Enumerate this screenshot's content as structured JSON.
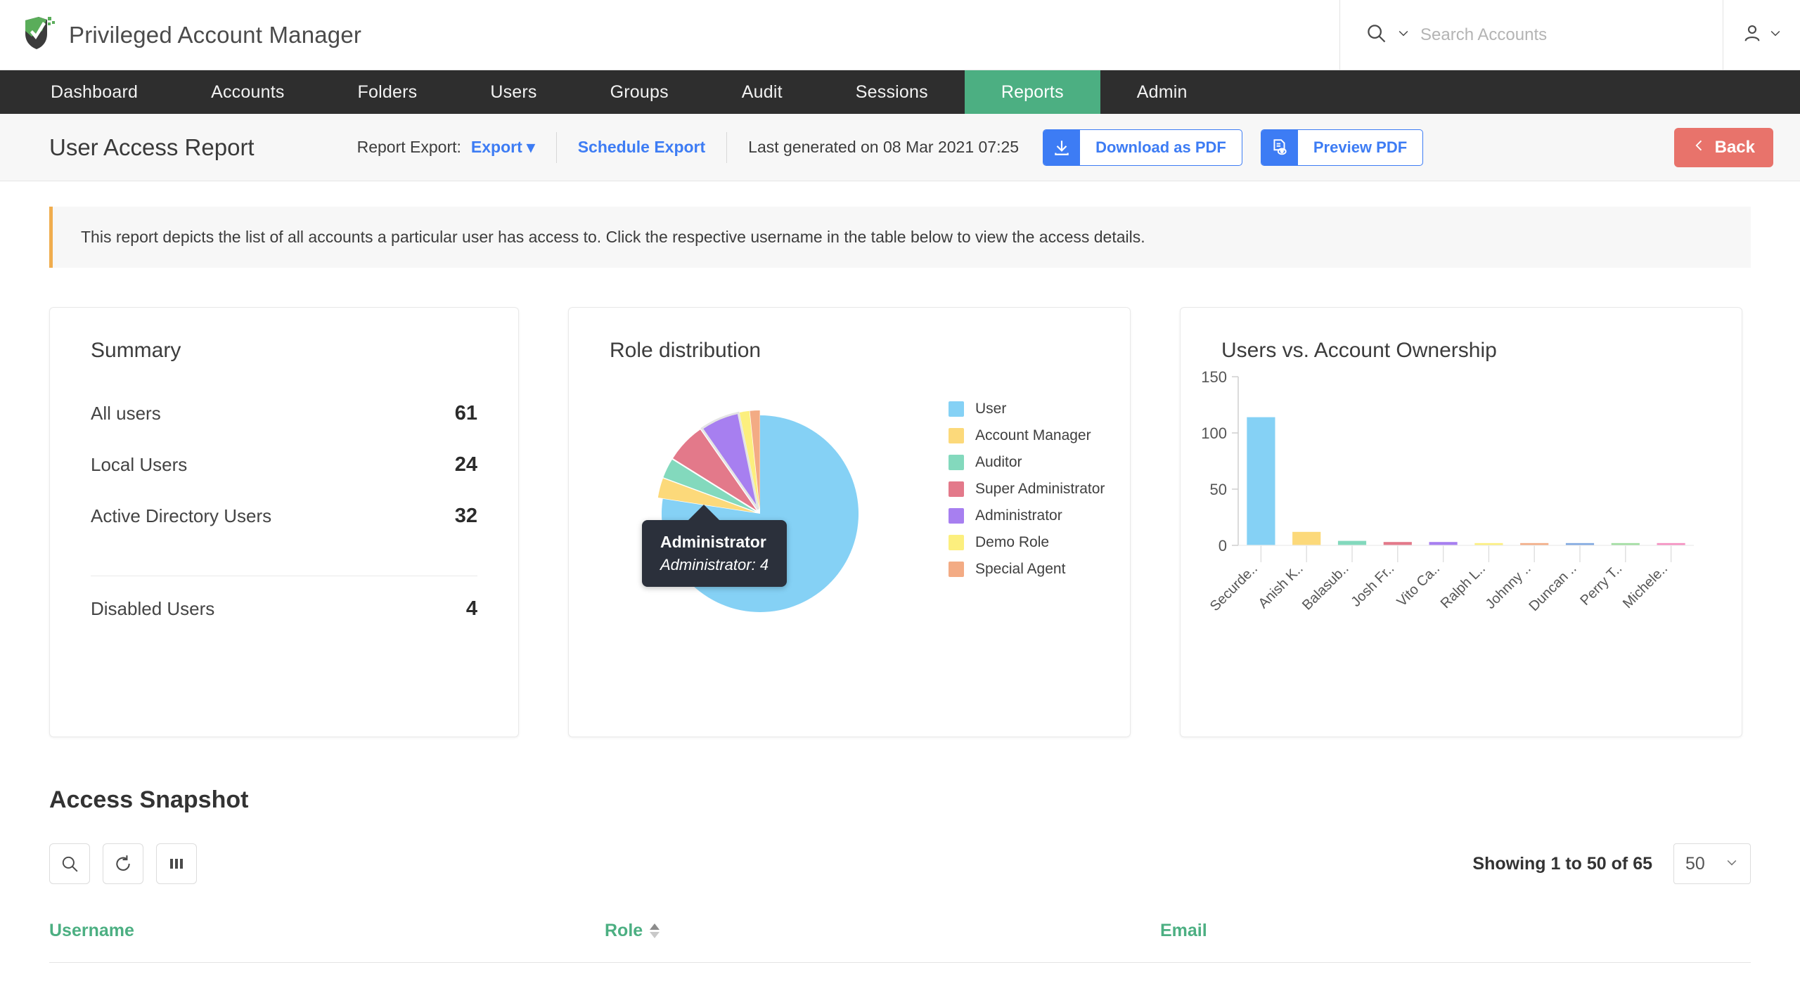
{
  "app": {
    "title": "Privileged Account Manager",
    "logo_icon": "shield-check-icon"
  },
  "search": {
    "icon": "search-icon",
    "dropdown_icon": "chevron-down-icon",
    "placeholder": "Search Accounts",
    "value": ""
  },
  "user_menu": {
    "icon": "user-icon",
    "dropdown_icon": "chevron-down-icon"
  },
  "nav": {
    "items": [
      {
        "label": "Dashboard",
        "active": false
      },
      {
        "label": "Accounts",
        "active": false
      },
      {
        "label": "Folders",
        "active": false
      },
      {
        "label": "Users",
        "active": false
      },
      {
        "label": "Groups",
        "active": false
      },
      {
        "label": "Audit",
        "active": false
      },
      {
        "label": "Sessions",
        "active": false
      },
      {
        "label": "Reports",
        "active": true
      },
      {
        "label": "Admin",
        "active": false
      }
    ],
    "active_color": "#4caf82",
    "bar_color": "#2e2e2e"
  },
  "toolbar": {
    "page_title": "User Access Report",
    "report_export_label": "Report Export:",
    "export_label": "Export",
    "export_caret": "caret-down-icon",
    "schedule_export_label": "Schedule Export",
    "last_generated": "Last generated on 08 Mar 2021 07:25",
    "download_pdf_label": "Download as PDF",
    "download_icon": "download-icon",
    "preview_pdf_label": "Preview PDF",
    "preview_icon": "document-eye-icon",
    "back_label": "Back",
    "back_icon": "chevron-left-icon",
    "link_color": "#3d7cf4",
    "back_color": "#e8736b"
  },
  "banner": {
    "text": "This report depicts the list of all accounts a particular user has access to. Click the respective username in the table below to view the access details.",
    "accent_color": "#f0ad4e"
  },
  "summary": {
    "title": "Summary",
    "rows": [
      {
        "label": "All users",
        "value": "61"
      },
      {
        "label": "Local Users",
        "value": "24"
      },
      {
        "label": "Active Directory Users",
        "value": "32"
      }
    ],
    "footer_row": {
      "label": "Disabled Users",
      "value": "4"
    }
  },
  "role_distribution": {
    "title": "Role distribution",
    "tooltip": {
      "title": "Administrator",
      "detail": "Administrator: 4"
    }
  },
  "ownership": {
    "title": "Users vs. Account Ownership"
  },
  "access_snapshot": {
    "title": "Access Snapshot",
    "buttons": [
      {
        "icon": "search-icon",
        "name": "search-button"
      },
      {
        "icon": "refresh-icon",
        "name": "refresh-button"
      },
      {
        "icon": "columns-icon",
        "name": "columns-button"
      }
    ],
    "showing_text": "Showing 1 to 50 of 65",
    "page_size": "50",
    "page_size_caret": "chevron-down-icon",
    "columns": [
      {
        "label": "Username",
        "sortable": false
      },
      {
        "label": "Role",
        "sortable": true
      },
      {
        "label": "Email",
        "sortable": false
      }
    ],
    "header_color": "#4caf82"
  },
  "chart_data": [
    {
      "type": "pie",
      "title": "Role distribution",
      "legend_position": "right",
      "categories": [
        "User",
        "Account Manager",
        "Auditor",
        "Super Administrator",
        "Administrator",
        "Demo Role",
        "Special Agent"
      ],
      "values": [
        48,
        2,
        2,
        4,
        4,
        1,
        1
      ],
      "colors": [
        "#85d1f5",
        "#fcd97a",
        "#83d9bd",
        "#e3798a",
        "#a77ff0",
        "#fcef7e",
        "#f3ab84"
      ],
      "highlighted": "Administrator",
      "tooltip": {
        "label": "Administrator",
        "series": "Administrator",
        "value": 4
      }
    },
    {
      "type": "bar",
      "title": "Users vs. Account Ownership",
      "xlabel": "",
      "ylabel": "",
      "ylim": [
        0,
        150
      ],
      "yticks": [
        0,
        50,
        100,
        150
      ],
      "grid": false,
      "categories": [
        "Securde..",
        "Anish K..",
        "Balasub..",
        "Josh Fr..",
        "Vito Ca..",
        "Ralph L..",
        "Johnny ..",
        "Duncan ..",
        "Perry T..",
        "Michele.."
      ],
      "values": [
        114,
        12,
        4,
        3,
        3,
        2,
        2,
        2,
        2,
        2
      ],
      "colors": [
        "#85d1f5",
        "#fcd97a",
        "#83d9bd",
        "#e3798a",
        "#a77ff0",
        "#fcef7e",
        "#f3ab84",
        "#7fa7e0",
        "#9fdd9f",
        "#f58ec0"
      ]
    }
  ]
}
